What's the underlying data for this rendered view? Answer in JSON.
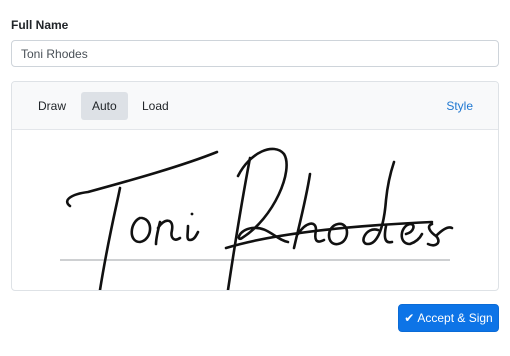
{
  "form": {
    "name_label": "Full Name",
    "name_value": "Toni Rhodes"
  },
  "signature": {
    "tabs": [
      {
        "label": "Draw",
        "active": false
      },
      {
        "label": "Auto",
        "active": true
      },
      {
        "label": "Load",
        "active": false
      }
    ],
    "style_label": "Style",
    "text": "Toni Rhodes"
  },
  "actions": {
    "accept_label": "Accept & Sign",
    "accept_icon": "check-icon"
  },
  "colors": {
    "accent": "#0d74e7",
    "link": "#1f78d1",
    "active_tab": "#dde1e6"
  }
}
